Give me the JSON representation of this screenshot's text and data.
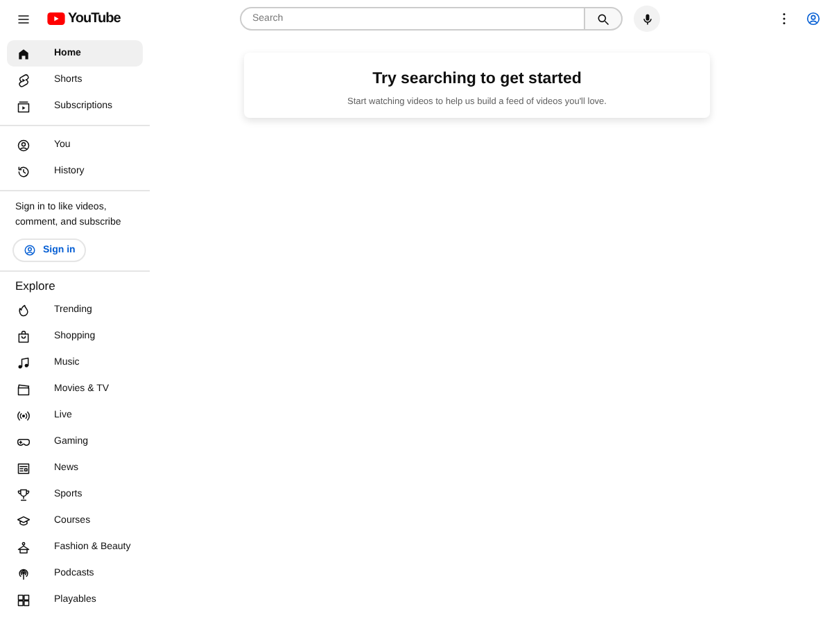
{
  "header": {
    "logo_text": "YouTube",
    "search": {
      "placeholder": "Search"
    }
  },
  "sidebar": {
    "main": [
      {
        "label": "Home",
        "selected": true
      },
      {
        "label": "Shorts",
        "selected": false
      },
      {
        "label": "Subscriptions",
        "selected": false
      }
    ],
    "you": [
      {
        "label": "You",
        "selected": false
      },
      {
        "label": "History",
        "selected": false
      }
    ],
    "signin_prompt": "Sign in to like videos, comment, and subscribe",
    "signin_button": "Sign in",
    "explore_title": "Explore",
    "explore": [
      {
        "label": "Trending",
        "selected": false
      },
      {
        "label": "Shopping",
        "selected": false
      },
      {
        "label": "Music",
        "selected": false
      },
      {
        "label": "Movies & TV",
        "selected": false
      },
      {
        "label": "Live",
        "selected": false
      },
      {
        "label": "Gaming",
        "selected": false
      },
      {
        "label": "News",
        "selected": false
      },
      {
        "label": "Sports",
        "selected": false
      },
      {
        "label": "Courses",
        "selected": false
      },
      {
        "label": "Fashion & Beauty",
        "selected": false
      },
      {
        "label": "Podcasts",
        "selected": false
      },
      {
        "label": "Playables",
        "selected": false
      }
    ]
  },
  "prompt": {
    "title": "Try searching to get started",
    "text": "Start watching videos to help us build a feed of videos you'll love."
  }
}
